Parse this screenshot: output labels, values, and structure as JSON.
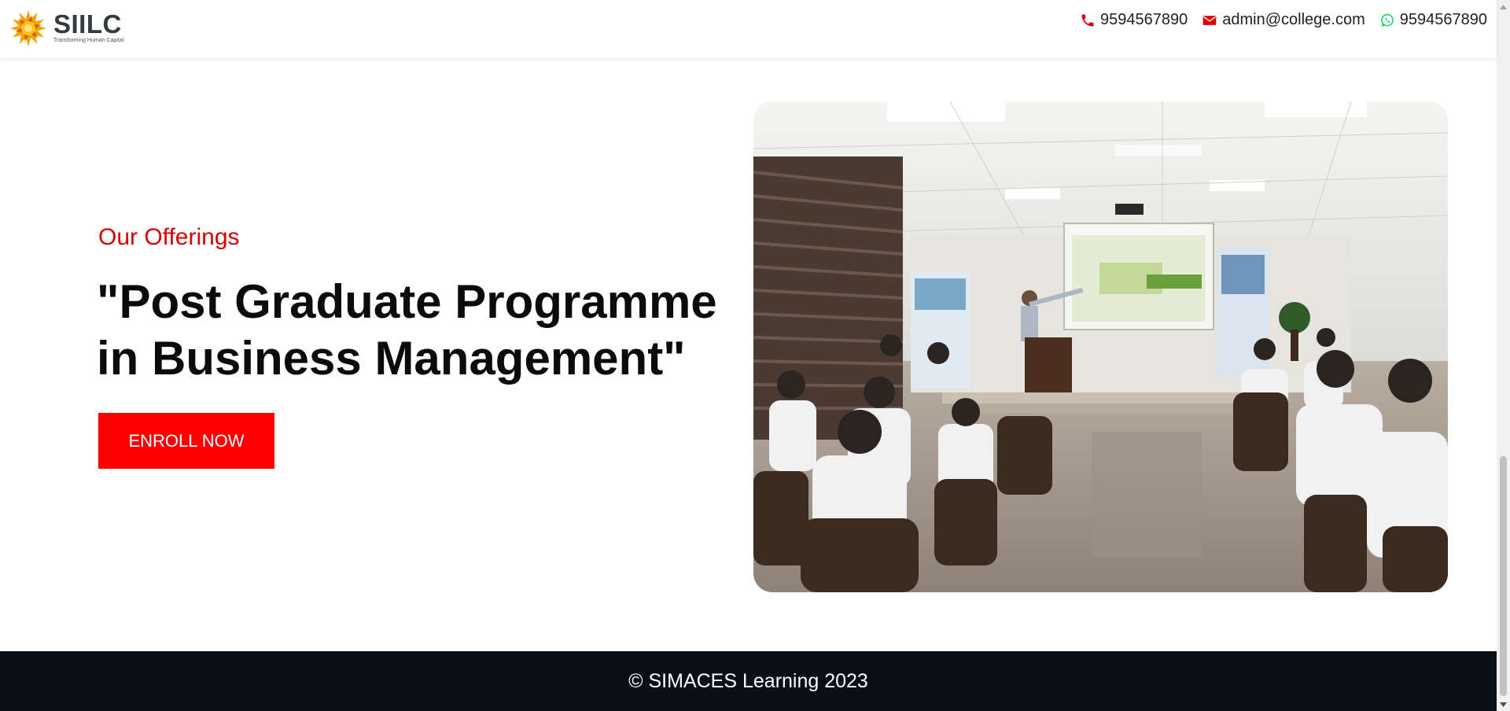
{
  "header": {
    "logo": {
      "text": "SIILC",
      "tagline": "Transforming Human Capital"
    },
    "contacts": [
      {
        "type": "phone",
        "icon": "phone-icon",
        "text": "9594567890",
        "color": "#e00000"
      },
      {
        "type": "email",
        "icon": "envelope-icon",
        "text": "admin@college.com",
        "color": "#e00000"
      },
      {
        "type": "whatsapp",
        "icon": "whatsapp-icon",
        "text": "9594567890",
        "color": "#25d366"
      }
    ]
  },
  "hero": {
    "eyebrow": "Our Offerings",
    "headline": "\"Post Graduate Programme in Business Management\"",
    "cta_label": "ENROLL NOW",
    "image": "classroom-seminar-photo"
  },
  "footer": {
    "copyright": "© SIMACES Learning 2023"
  },
  "colors": {
    "accent": "#ff0000",
    "eyebrow": "#d40000",
    "footer_bg": "#0a0f1a"
  }
}
